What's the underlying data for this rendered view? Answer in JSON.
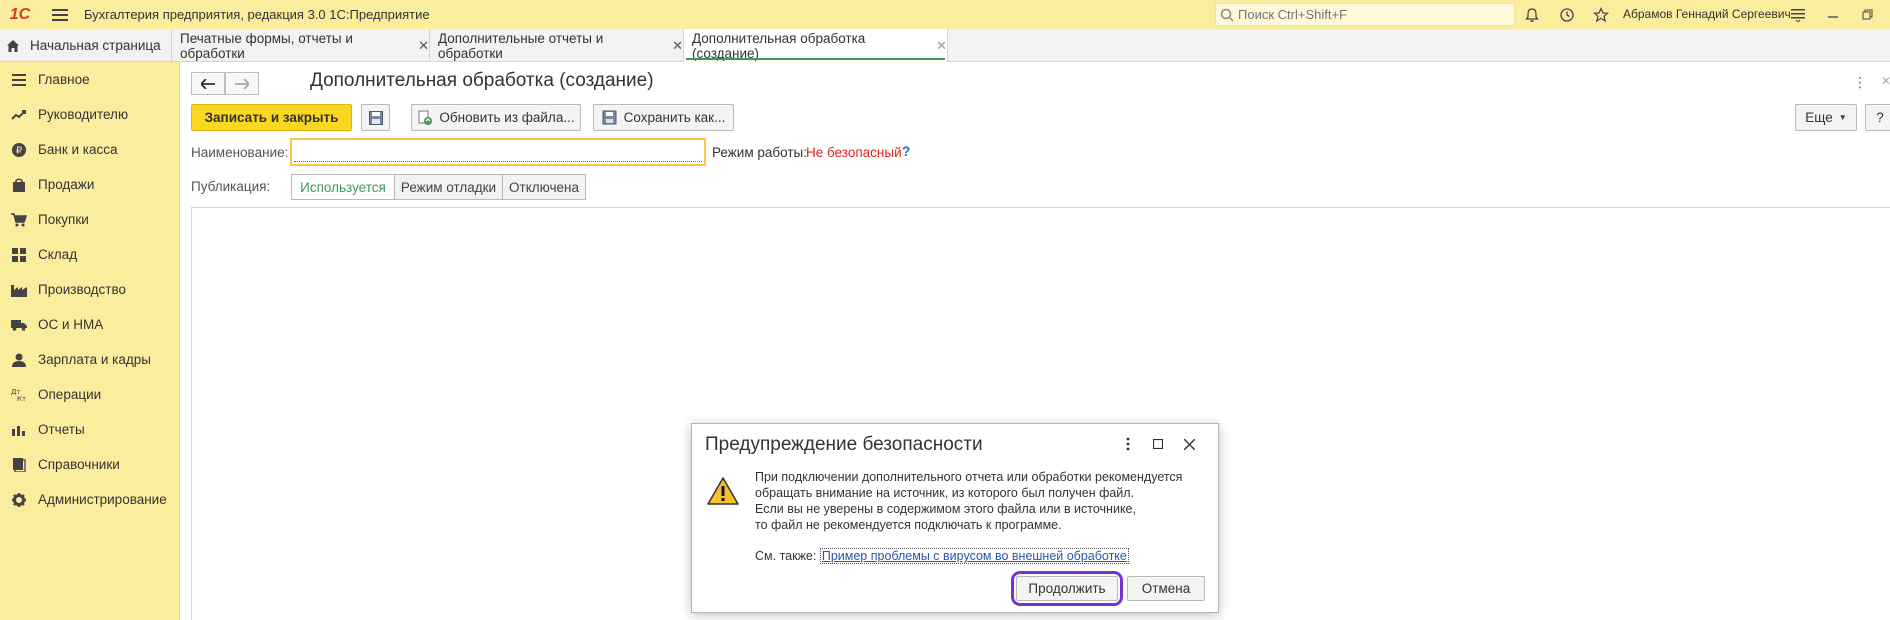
{
  "app": {
    "logo": "1С",
    "title": "Бухгалтерия предприятия, редакция 3.0 1С:Предприятие",
    "search_placeholder": "Поиск Ctrl+Shift+F",
    "user": "Абрамов Геннадий Сергеевич"
  },
  "tabs": {
    "home": "Начальная страница",
    "items": [
      "Печатные формы, отчеты и обработки",
      "Дополнительные отчеты и обработки",
      "Дополнительная обработка (создание)"
    ]
  },
  "sidebar": {
    "items": [
      {
        "label": "Главное",
        "icon": "menu-icon"
      },
      {
        "label": "Руководителю",
        "icon": "trend-icon"
      },
      {
        "label": "Банк и касса",
        "icon": "ruble-icon"
      },
      {
        "label": "Продажи",
        "icon": "bag-icon"
      },
      {
        "label": "Покупки",
        "icon": "cart-icon"
      },
      {
        "label": "Склад",
        "icon": "grid-icon"
      },
      {
        "label": "Производство",
        "icon": "factory-icon"
      },
      {
        "label": "ОС и НМА",
        "icon": "truck-icon"
      },
      {
        "label": "Зарплата и кадры",
        "icon": "person-icon"
      },
      {
        "label": "Операции",
        "icon": "dt-kt-icon"
      },
      {
        "label": "Отчеты",
        "icon": "bar-chart-icon"
      },
      {
        "label": "Справочники",
        "icon": "book-icon"
      },
      {
        "label": "Администрирование",
        "icon": "gear-icon"
      }
    ]
  },
  "form": {
    "title": "Дополнительная обработка (создание)",
    "save_close": "Записать и закрыть",
    "update_from_file": "Обновить из файла...",
    "save_as": "Сохранить как...",
    "more": "Еще",
    "help": "?",
    "name_label": "Наименование:",
    "name_value": "",
    "mode_label": "Режим работы:",
    "mode_value": "Не безопасный",
    "mode_help": "?",
    "publication_label": "Публикация:",
    "publication_options": [
      "Используется",
      "Режим отладки",
      "Отключена"
    ]
  },
  "dialog": {
    "title": "Предупреждение безопасности",
    "text": [
      "При подключении дополнительного отчета или обработки рекомендуется",
      "обращать внимание на источник, из которого был получен файл.",
      "Если вы не уверены в содержимом этого файла или в источнике,",
      "то файл не рекомендуется подключать к программе."
    ],
    "see_also_label": "См. также:",
    "see_also_link": "Пример проблемы с вирусом во внешней обработке",
    "continue": "Продолжить",
    "cancel": "Отмена"
  },
  "colors": {
    "panel": "#fbed9e",
    "primary_button": "#fad820",
    "active_green": "#3e9a58",
    "danger_red": "#e0271a",
    "highlight": "#7b2fd6"
  }
}
